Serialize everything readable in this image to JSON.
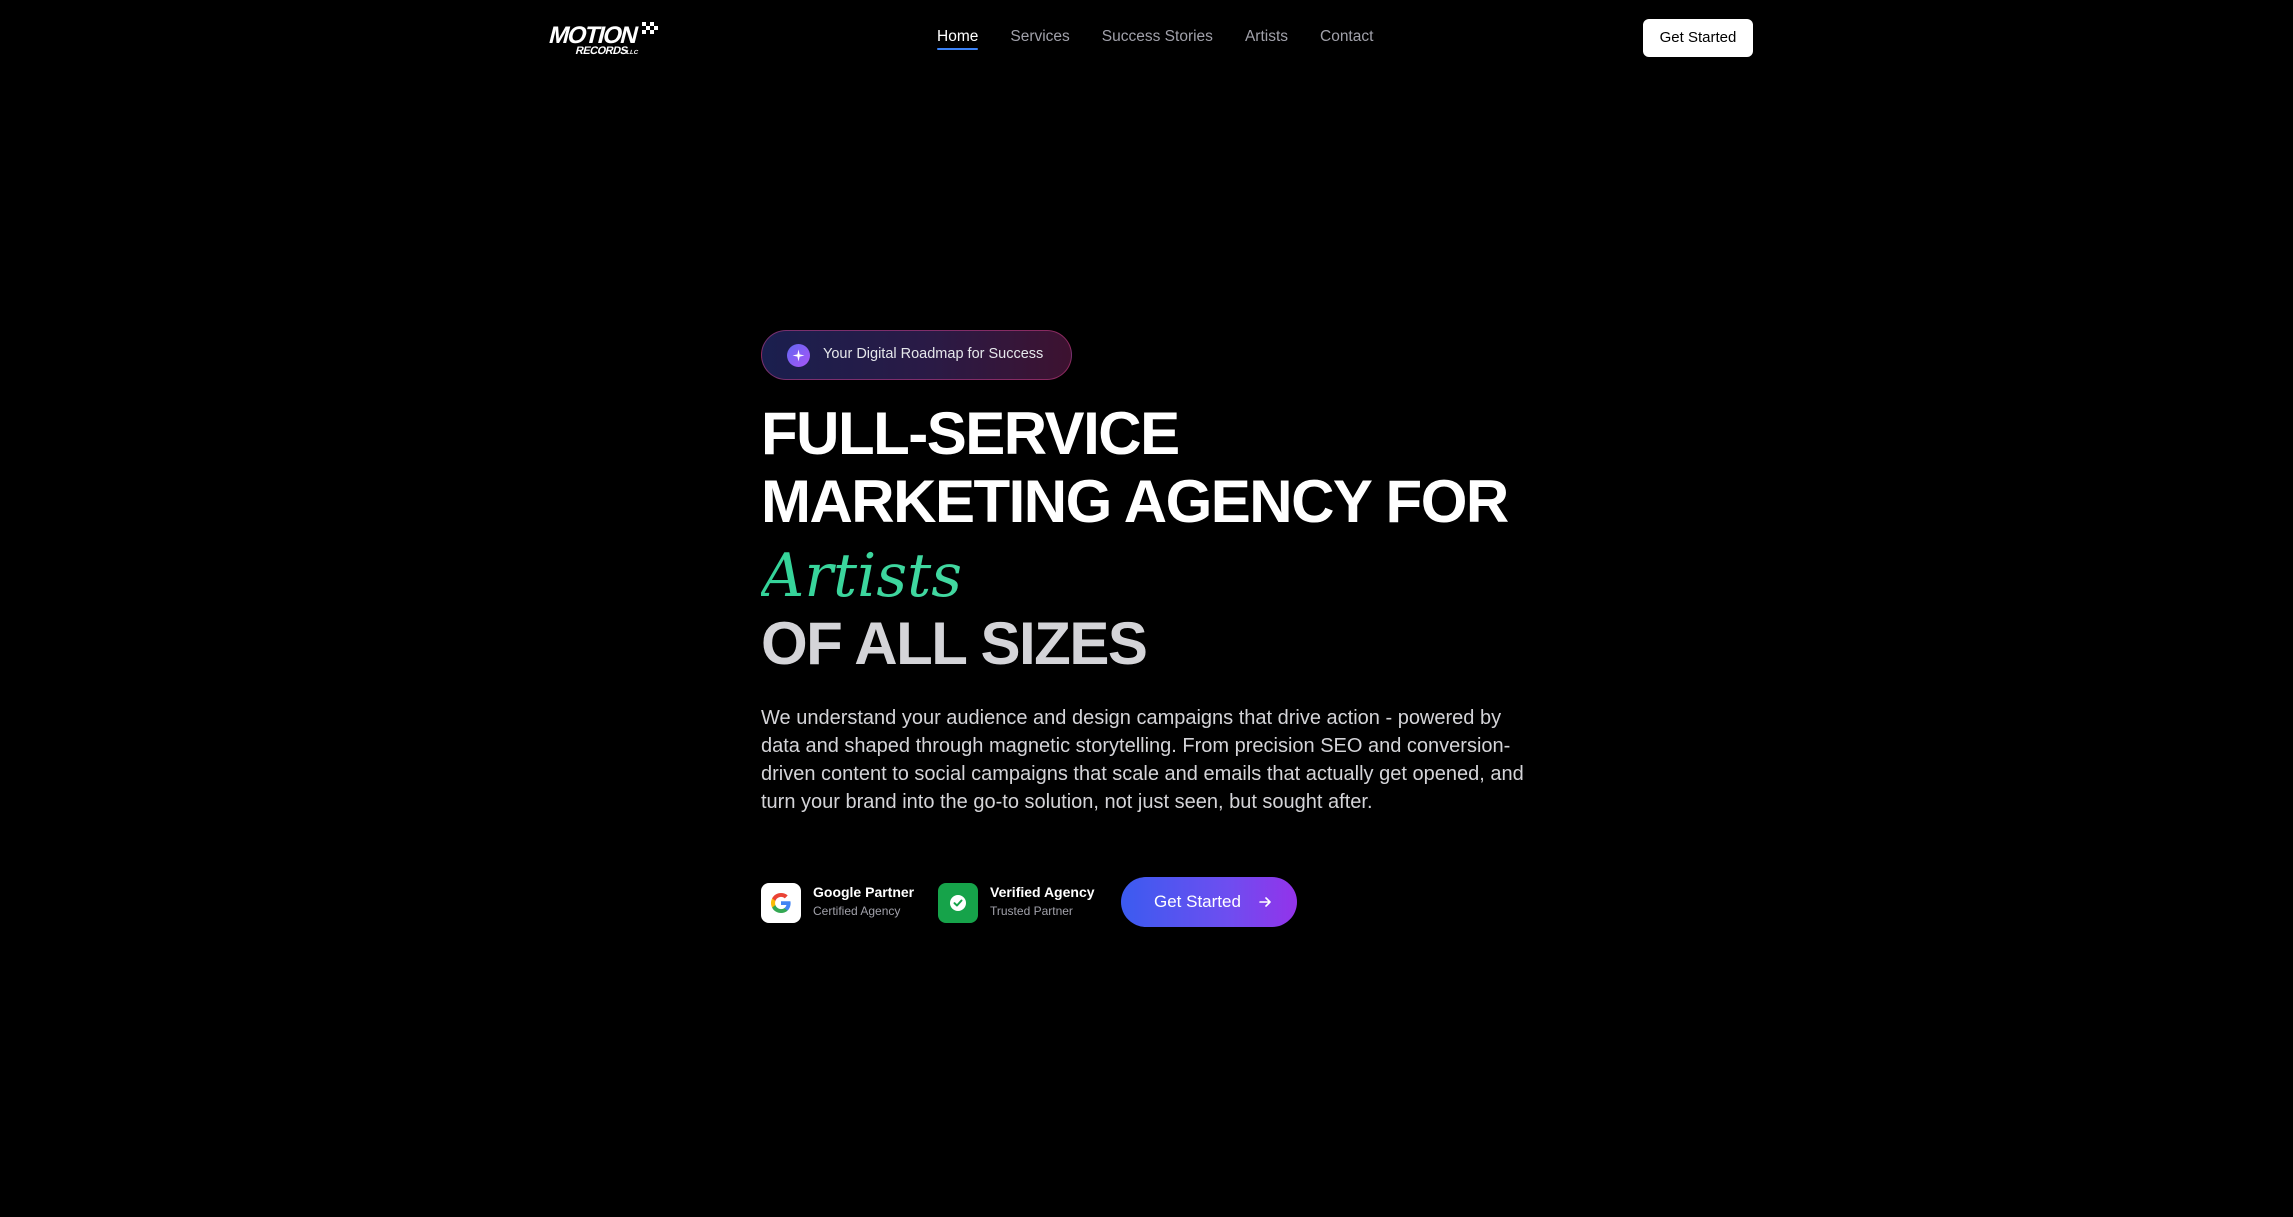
{
  "header": {
    "logo_text": "MOTION RECORDS LLC",
    "nav": [
      {
        "label": "Home",
        "active": true
      },
      {
        "label": "Services",
        "active": false
      },
      {
        "label": "Success Stories",
        "active": false
      },
      {
        "label": "Artists",
        "active": false
      },
      {
        "label": "Contact",
        "active": false
      }
    ],
    "cta_label": "Get Started"
  },
  "hero": {
    "pill_text": "Your Digital Roadmap for Success",
    "pill_icon": "sparkle-icon",
    "headline_line1": "FULL-SERVICE",
    "headline_line2": "MARKETING AGENCY FOR",
    "headline_highlight": "Artists",
    "headline_line4": "OF ALL SIZES",
    "description": "We understand your audience and design campaigns that drive action - powered by data and shaped through magnetic storytelling. From precision SEO and conversion-driven content to social campaigns that scale and emails that actually get opened, and turn your brand into the go-to solution, not just seen, but sought after.",
    "badges": [
      {
        "title": "Google Partner",
        "subtitle": "Certified Agency",
        "icon": "google-icon"
      },
      {
        "title": "Verified Agency",
        "subtitle": "Trusted Partner",
        "icon": "check-badge-icon"
      }
    ],
    "cta_label": "Get Started",
    "cta_icon": "arrow-right-icon"
  },
  "colors": {
    "background": "#000000",
    "accent_blue": "#3b82f6",
    "highlight_green": "#4ade80",
    "cta_gradient_start": "#3b5bf0",
    "cta_gradient_end": "#9333ea",
    "verified_green": "#16a34a"
  }
}
